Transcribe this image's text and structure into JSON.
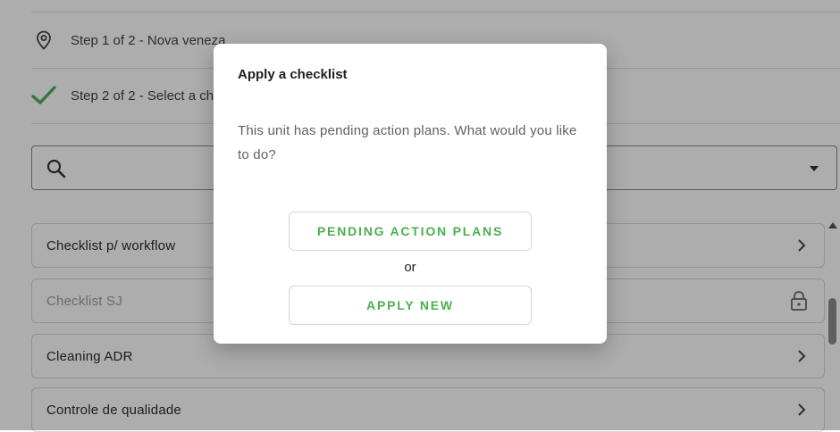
{
  "steps": [
    {
      "label": "Step 1 of 2 - Nova veneza",
      "icon": "map-pin-icon"
    },
    {
      "label": "Step 2 of 2 - Select a ch",
      "icon": "check-icon"
    }
  ],
  "search": {
    "placeholder": "",
    "value": "",
    "icon": "search-icon"
  },
  "checklists": [
    {
      "label": "Checklist p/ workflow",
      "icon": "chevron-right-icon",
      "disabled": false
    },
    {
      "label": "Checklist SJ",
      "icon": "lock-icon",
      "disabled": true
    },
    {
      "label": "Cleaning ADR",
      "icon": "chevron-right-icon",
      "disabled": false
    },
    {
      "label": "Controle de qualidade",
      "icon": "chevron-right-icon",
      "disabled": false
    }
  ],
  "dialog": {
    "title": "Apply a checklist",
    "message": "This unit has pending action plans. What would you like to do?",
    "pending_button": "PENDING ACTION PLANS",
    "or_text": "or",
    "apply_new_button": "APPLY NEW"
  },
  "colors": {
    "accent": "#4caf50",
    "overlay": "rgba(0,0,0,0.32)"
  }
}
